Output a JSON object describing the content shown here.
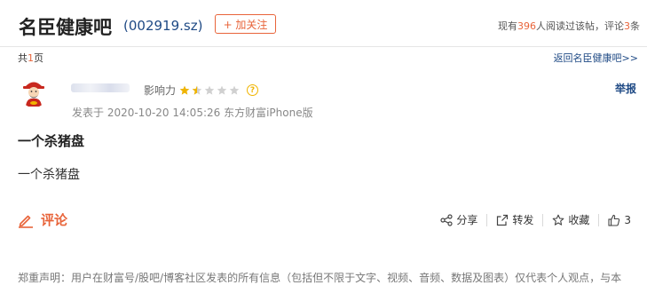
{
  "header": {
    "bar_title": "名臣健康吧",
    "stock_code": "(002919.sz)",
    "follow_label": "+ 加关注",
    "stats": {
      "prefix": "现有",
      "readers": "396",
      "mid": "人阅读过该帖，评论",
      "comments": "3",
      "suffix": "条"
    }
  },
  "pagination": {
    "prefix": "共",
    "pages": "1",
    "suffix": "页",
    "back_link": "返回名臣健康吧>>"
  },
  "post": {
    "author": {
      "influence_label": "影响力",
      "influence_rating": 1.5,
      "influence_max": 5,
      "report_label": "举报"
    },
    "meta": "发表于 2020-10-20 14:05:26 东方财富iPhone版",
    "title": "一个杀猪盘",
    "body": "一个杀猪盘"
  },
  "comment_bar": {
    "tab_label": "评论",
    "share_label": "分享",
    "repost_label": "转发",
    "favorite_label": "收藏",
    "like_count": "3"
  },
  "footer": {
    "disclaimer": "郑重声明：用户在财富号/股吧/博客社区发表的所有信息（包括但不限于文字、视频、音频、数据及图表）仅代表个人观点，与本"
  },
  "colors": {
    "accent": "#e8643a",
    "link": "#1f4a85",
    "star": "#f0b400"
  }
}
